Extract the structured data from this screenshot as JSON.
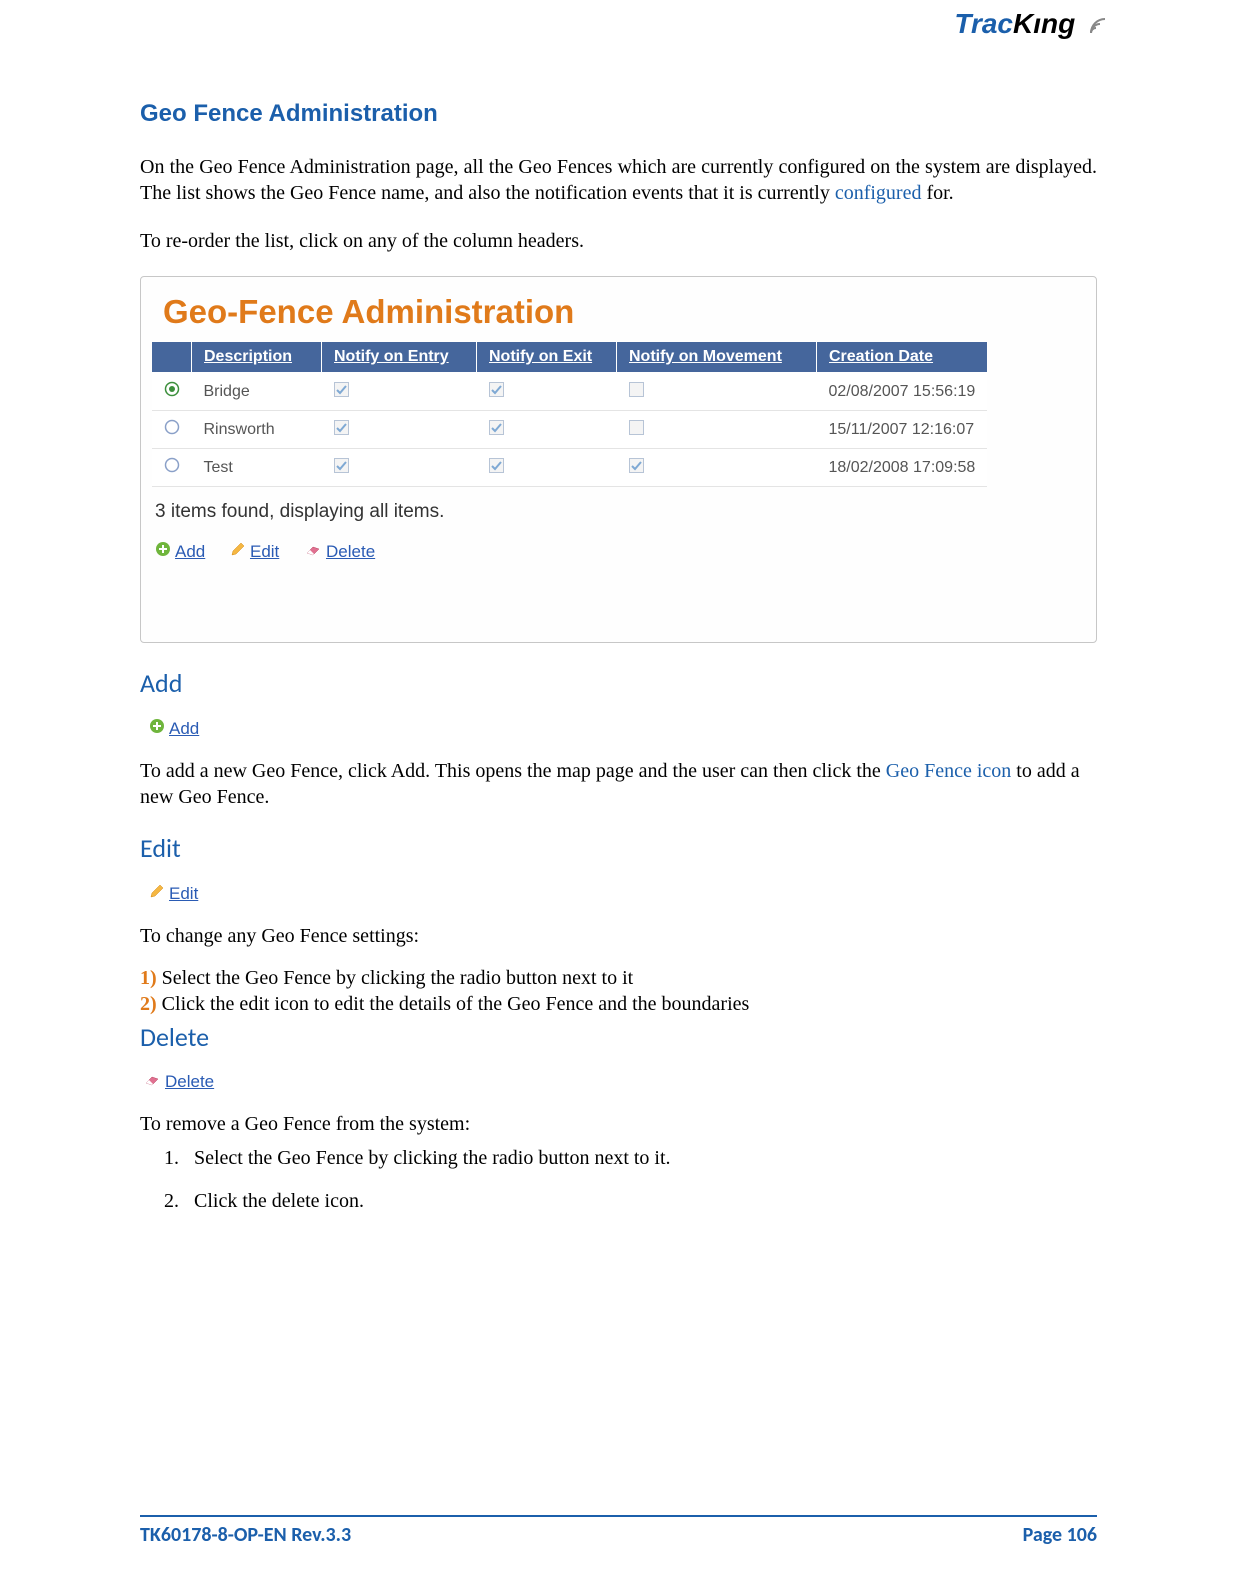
{
  "logo": {
    "part1": "Trac",
    "part2": "Kıng"
  },
  "heading": "Geo Fence Administration",
  "intro_p1a": "On the Geo Fence Administration page, all the Geo Fences which are currently configured on the system are displayed.  The list shows the Geo Fence name, and also the notification events that it is currently ",
  "intro_p1_link": "configured",
  "intro_p1b": " for.",
  "intro_p2": "To re-order the list, click on any of the column headers.",
  "screenshot": {
    "title": "Geo-Fence Administration",
    "headers": [
      "",
      "Description",
      "Notify on Entry",
      "Notify on Exit",
      "Notify on Movement",
      "Creation Date"
    ],
    "rows": [
      {
        "selected": true,
        "desc": "Bridge",
        "entry": true,
        "exit": true,
        "move": false,
        "date": "02/08/2007 15:56:19"
      },
      {
        "selected": false,
        "desc": "Rinsworth",
        "entry": true,
        "exit": true,
        "move": false,
        "date": "15/11/2007 12:16:07"
      },
      {
        "selected": false,
        "desc": "Test",
        "entry": true,
        "exit": true,
        "move": true,
        "date": "18/02/2008 17:09:58"
      }
    ],
    "summary": "3 items found, displaying all items.",
    "actions": {
      "add": "Add",
      "edit": "Edit",
      "delete": "Delete"
    }
  },
  "add": {
    "heading": "Add",
    "icon_label": "Add",
    "text_a": "To add a new Geo Fence, click Add. This opens the map page and the user can then click the ",
    "text_link": "Geo Fence icon",
    "text_b": " to add a new Geo Fence."
  },
  "edit": {
    "heading": "Edit",
    "icon_label": "Edit",
    "intro": "To change any Geo Fence settings:",
    "step1_num": "1)",
    "step1": " Select the Geo Fence by clicking the radio button next to it",
    "step2_num": "2)",
    "step2": " Click the edit icon to edit the details of the Geo Fence and the boundaries"
  },
  "delete": {
    "heading": "Delete",
    "icon_label": "Delete",
    "intro": "To remove a Geo Fence from the system:",
    "step1": "Select the Geo Fence by clicking the radio button next to it.",
    "step2": "Click the delete icon."
  },
  "footer": {
    "left": "TK60178-8-OP-EN Rev.3.3",
    "right": "Page  106"
  }
}
